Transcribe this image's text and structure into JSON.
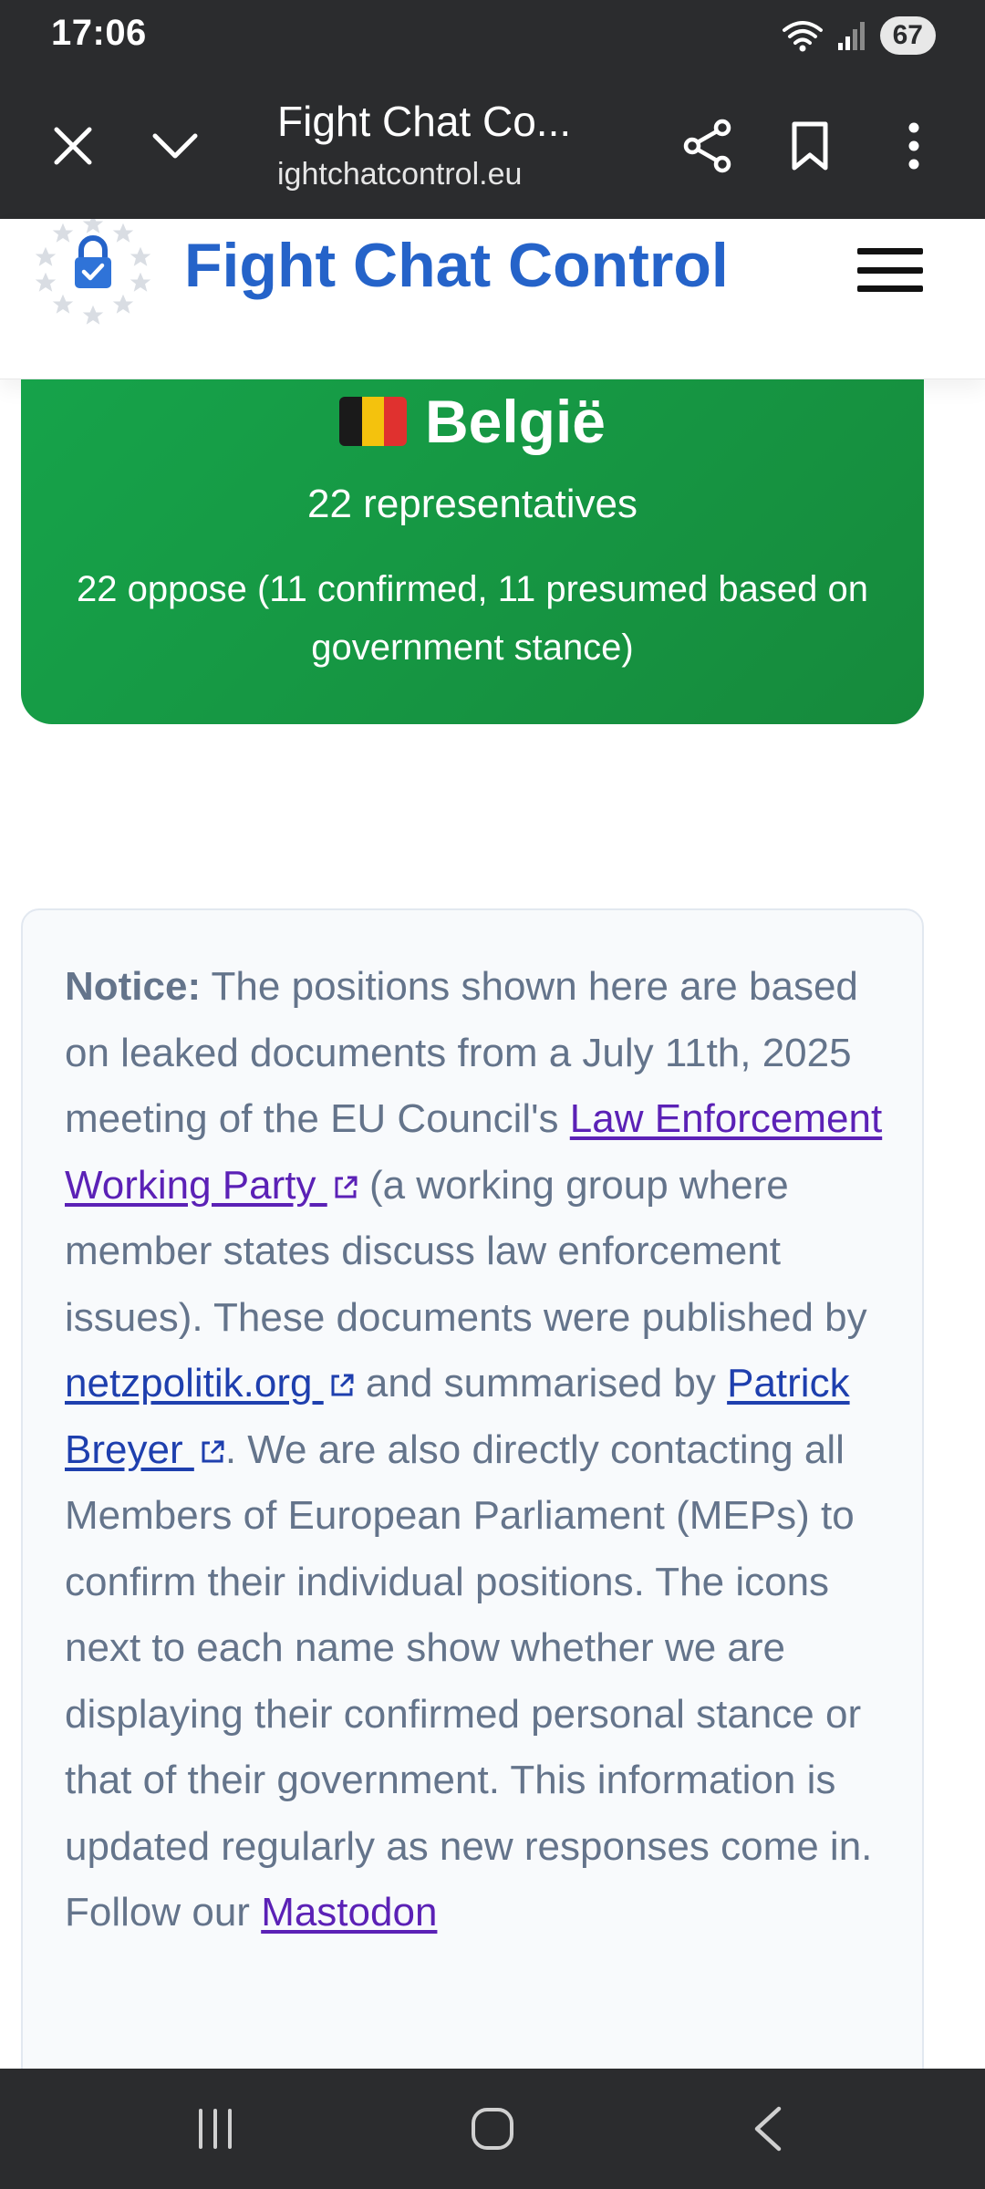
{
  "status_bar": {
    "time": "17:06",
    "battery": "67"
  },
  "browser": {
    "page_title": "Fight Chat Co...",
    "url": "ightchatcontrol.eu"
  },
  "site": {
    "name": "Fight Chat Control"
  },
  "country": {
    "name": "België",
    "representatives": "22 representatives",
    "summary": "22 oppose (11 confirmed, 11 presumed based on government stance)",
    "flag_colors": [
      "#1a1a1a",
      "#f4c20d",
      "#e0312f"
    ]
  },
  "notice": {
    "label": "Notice:",
    "text_1": " The positions shown here are based on leaked documents from a July 11th, 2025 meeting of the EU Council's ",
    "link_1": "Law Enforcement Working Party ",
    "text_2": " (a working group where member states discuss law enforcement issues). These documents were published by ",
    "link_2": "netzpolitik.org ",
    "text_3": " and summarised by ",
    "link_3": "Patrick Breyer ",
    "text_4": ". We are also directly contacting all Members of European Parliament (MEPs) to confirm their individual positions. The icons next to each name show whether we are displaying their confirmed personal stance or that of their government. This information is updated regularly as new responses come in. Follow our ",
    "link_4": "Mastodon"
  },
  "colors": {
    "brand_blue": "#2563c9",
    "card_green": "#16a34a",
    "chrome_dark": "#2b2c2e"
  }
}
